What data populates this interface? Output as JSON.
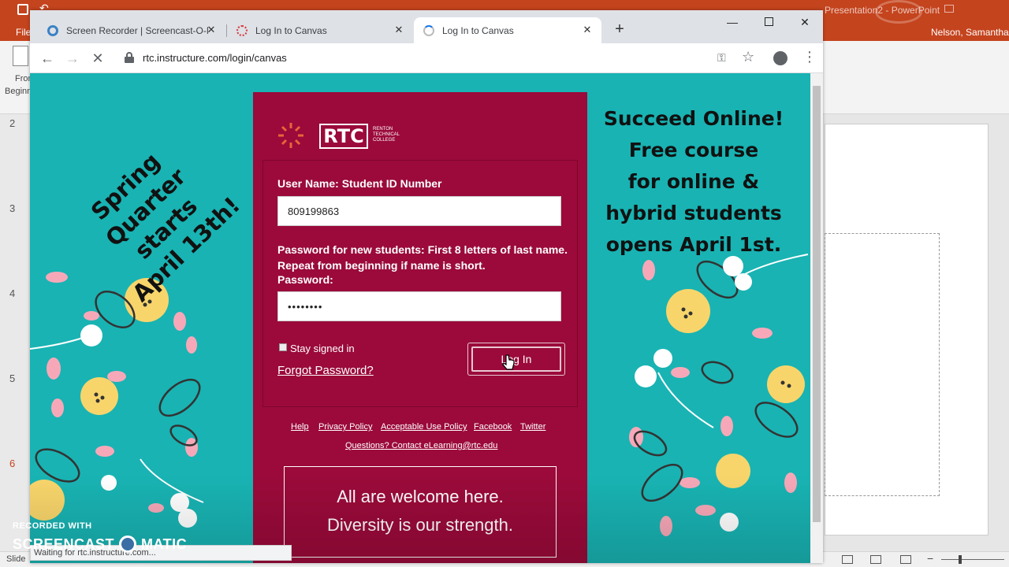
{
  "powerpoint": {
    "title": "Presentation2 - PowerPoint",
    "user": "Nelson, Samantha",
    "file_tab": "File",
    "ribbon_from_beginning": [
      "From",
      "Beginning"
    ],
    "slide_numbers": [
      "2",
      "3",
      "4",
      "5",
      "6"
    ],
    "status_left": "Slide",
    "accent_color": "#c4441e"
  },
  "browser": {
    "tabs": [
      {
        "title": "Screen Recorder | Screencast-O-Matic",
        "icon": "screencast-icon"
      },
      {
        "title": "Log In to Canvas",
        "icon": "canvas-icon"
      },
      {
        "title": "Log In to Canvas",
        "icon": "loading-spinner-icon"
      }
    ],
    "new_tab_label": "+",
    "url": "rtc.instructure.com/login/canvas",
    "status_text": "Waiting for rtc.instructure.com..."
  },
  "page": {
    "background_color": "#19b3b3",
    "panel_color": "#9b0a3a",
    "promo_left": [
      "Spring",
      "Quarter",
      "starts",
      "April 13th!"
    ],
    "promo_right": [
      "Succeed Online!",
      "Free course",
      "for online &",
      "hybrid students",
      "opens April 1st."
    ],
    "logo": {
      "text": "RTC",
      "subtext": [
        "RENTON",
        "TECHNICAL",
        "COLLEGE"
      ]
    },
    "username_label": "User Name: Student ID Number",
    "username_value": "809199863",
    "password_hint": "Password for new students: First 8 letters of last name. Repeat from beginning if name is short.",
    "password_label": "Password:",
    "password_value": "••••••••",
    "stay_signed_in": "Stay signed in",
    "forgot_password": "Forgot Password?",
    "login_button": "Log In",
    "footer_links": [
      "Help",
      "Privacy Policy",
      "Acceptable Use Policy",
      "Facebook",
      "Twitter"
    ],
    "contact_link": "Questions? Contact eLearning@rtc.edu",
    "welcome_lines": [
      "All are welcome here.",
      "Diversity is our strength."
    ]
  },
  "watermark": {
    "recorded_with": "RECORDED WITH",
    "brand_left": "SCREENCAST",
    "brand_right": "MATIC"
  }
}
